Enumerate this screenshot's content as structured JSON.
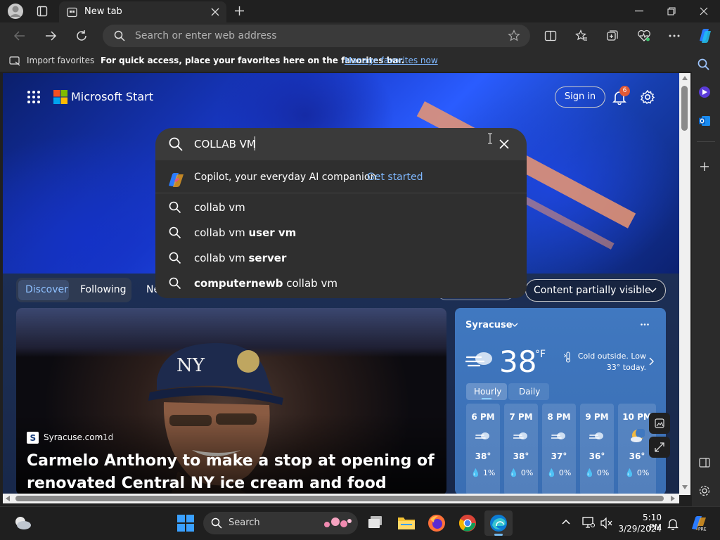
{
  "browser": {
    "tab_title": "New tab",
    "address_placeholder": "Search or enter web address"
  },
  "favorites_bar": {
    "import_label": "Import favorites",
    "hint_text": "For quick access, place your favorites here on the favorites bar.",
    "manage_link": "Manage favorites now"
  },
  "page": {
    "brand": "Microsoft Start",
    "sign_in": "Sign in",
    "notification_count": "6"
  },
  "search": {
    "query": "COLLAB VM",
    "copilot_text": "Copilot, your everyday AI companion.",
    "copilot_link": "Get started",
    "suggestions": [
      {
        "plain": "collab vm",
        "bold": ""
      },
      {
        "plain": "collab vm ",
        "bold": "user vm"
      },
      {
        "plain": "collab vm ",
        "bold": "server"
      },
      {
        "bold_prefix": "computernewb",
        "plain": " collab vm"
      }
    ]
  },
  "feed_tabs": {
    "discover": "Discover",
    "following": "Following",
    "partial": "Ne",
    "content_visibility": "Content partially visible"
  },
  "news": {
    "source": "Syracuse.com",
    "age": "1d",
    "headline": "Carmelo Anthony to make a stop at opening of renovated Central NY ice cream and food drive-in"
  },
  "weather": {
    "city": "Syracuse",
    "temp": "38",
    "unit": "°F",
    "summary": "Cold outside. Low 33° today.",
    "tab_hourly": "Hourly",
    "tab_daily": "Daily",
    "hours": [
      {
        "time": "6 PM",
        "temp": "38°",
        "precip": "1%"
      },
      {
        "time": "7 PM",
        "temp": "38°",
        "precip": "0%"
      },
      {
        "time": "8 PM",
        "temp": "37°",
        "precip": "0%"
      },
      {
        "time": "9 PM",
        "temp": "36°",
        "precip": "0%"
      },
      {
        "time": "10 PM",
        "temp": "36°",
        "precip": "0%"
      }
    ]
  },
  "taskbar": {
    "search_label": "Search",
    "time": "5:10 PM",
    "date": "3/29/2024"
  },
  "colors": {
    "accent_link": "#7fb8ff",
    "notification_badge": "#e25a36",
    "windows_blue": "#3aa0ff"
  }
}
